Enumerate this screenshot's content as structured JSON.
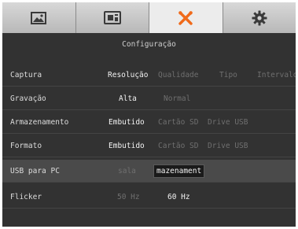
{
  "tabs": [
    {
      "name": "image-icon",
      "active": false
    },
    {
      "name": "camera-settings-icon",
      "active": false
    },
    {
      "name": "tools-icon",
      "active": true
    },
    {
      "name": "gear-icon",
      "active": false
    }
  ],
  "colors": {
    "accent": "#f06a1a",
    "panel": "#323232"
  },
  "header": {
    "title": "Configuração"
  },
  "rows": [
    {
      "label": "Captura",
      "options": [
        "Resolução",
        "Qualidade",
        "Tipo",
        "Intervalo"
      ]
    },
    {
      "label": "Gravação",
      "options": [
        "Alta",
        "Normal"
      ]
    },
    {
      "label": "Armazenamento",
      "options": [
        "Embutido",
        "Cartão SD",
        "Drive USB"
      ]
    },
    {
      "label": "Formato",
      "options": [
        "Embutido",
        "Cartão SD",
        "Drive USB"
      ]
    },
    {
      "label": "USB para PC",
      "options": [
        "sala",
        "mazenament"
      ]
    },
    {
      "label": "Flicker",
      "options": [
        "50 Hz",
        "60 Hz"
      ]
    }
  ]
}
